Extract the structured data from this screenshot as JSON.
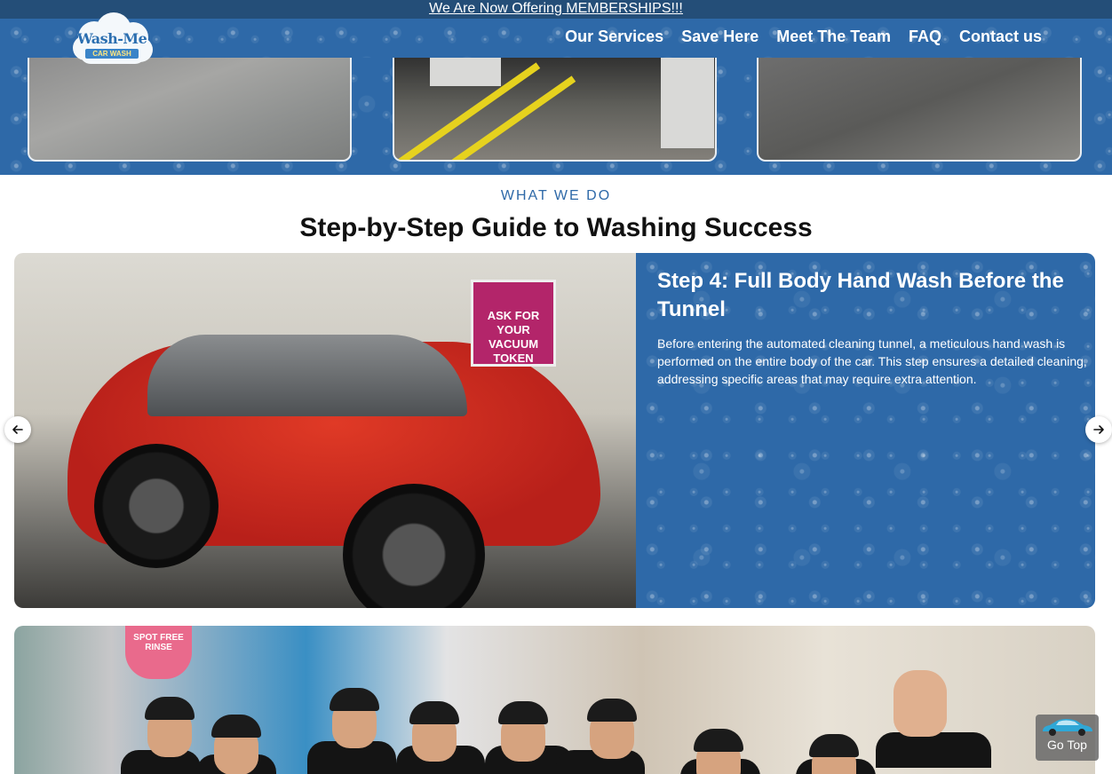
{
  "announcement": {
    "text": "We Are Now Offering MEMBERSHIPS!!!"
  },
  "brand": {
    "logo_main": "Wash-Me",
    "logo_sub": "CAR WASH"
  },
  "nav": {
    "items": [
      {
        "label": "Our Services"
      },
      {
        "label": "Save Here"
      },
      {
        "label": "Meet The Team"
      },
      {
        "label": "FAQ"
      },
      {
        "label": "Contact us"
      }
    ]
  },
  "section": {
    "eyebrow": "WHAT WE DO",
    "title": "Step-by-Step Guide to Washing Success"
  },
  "carousel": {
    "slide": {
      "title": "Step 4: Full Body Hand Wash Before the Tunnel",
      "description": "Before entering the automated cleaning tunnel, a meticulous hand wash is performed on the entire body of the car. This step ensures a detailed cleaning, addressing specific areas that may require extra attention.",
      "photo_sign": "ASK FOR YOUR VACUUM TOKEN"
    }
  },
  "team_photo": {
    "sign_text": "SPOT FREE RINSE"
  },
  "go_top": {
    "label": "Go Top"
  },
  "colors": {
    "brand_blue": "#2e69a8",
    "topbar": "#244e78"
  }
}
